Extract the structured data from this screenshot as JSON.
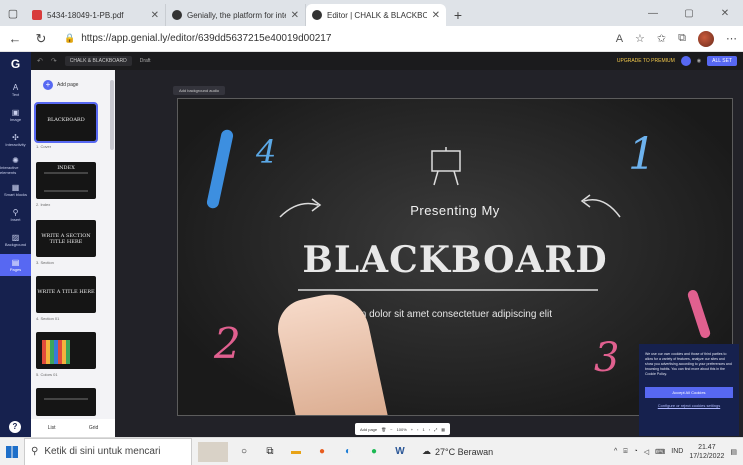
{
  "browser": {
    "tabs": [
      {
        "title": "5434-18049-1-PB.pdf",
        "favicon": "pdf-icon",
        "active": false
      },
      {
        "title": "Genially, the platform for interac",
        "favicon": "genially-icon",
        "active": false
      },
      {
        "title": "Editor | CHALK & BLACKBOARD",
        "favicon": "genially-icon",
        "active": true
      }
    ],
    "url": "https://app.genial.ly/editor/639dd5637215e40019d00217"
  },
  "editor": {
    "top_name": "CHALK & BLACKBOARD",
    "top_chip": "Draft",
    "upgrade_label": "UPGRADE TO PREMIUM",
    "all_set_label": "ALL SET",
    "rail": [
      {
        "label": "Text",
        "icon": "A"
      },
      {
        "label": "Image",
        "icon": "▣"
      },
      {
        "label": "Interactivity",
        "icon": "✣"
      },
      {
        "label": "Interactive elements",
        "icon": "✺"
      },
      {
        "label": "Smart blocks",
        "icon": "▦"
      },
      {
        "label": "Insert",
        "icon": "⚲"
      },
      {
        "label": "Background",
        "icon": "▨"
      },
      {
        "label": "Pages",
        "icon": "▤"
      }
    ],
    "add_page_label": "Add page",
    "thumbnails": [
      {
        "label": "1. Cover",
        "text": "BLACKBOARD"
      },
      {
        "label": "2. Index",
        "text": "INDEX"
      },
      {
        "label": "3. Section",
        "text": "WRITE A SECTION TITLE HERE"
      },
      {
        "label": "4. Section 01",
        "text": "WRITE A TITLE HERE"
      },
      {
        "label": "5. Colors 01",
        "text": ""
      },
      {
        "label": "6.",
        "text": ""
      }
    ],
    "panel_footer": {
      "list": "List",
      "grid": "Grid"
    },
    "canvas_tool_label": "Add background audio",
    "slide": {
      "presenting": "Presenting My",
      "title": "BLACKBOARD",
      "subtitle": "m dolor sit amet consectetuer adipiscing elit",
      "numbers": [
        "4",
        "1",
        "2",
        "3"
      ]
    },
    "zoom_bar": {
      "add_page": "Add page",
      "zoom": "100%",
      "page": "1"
    },
    "cookie": {
      "text": "We use our own cookies and those of third parties to allow for a variety of features, analyze our sites and show you advertising according to your preferences and browsing habits. You can find more about this in the Cookie Policy.",
      "accept": "Accept All Cookies",
      "configure": "Configure or reject cookies settings"
    }
  },
  "taskbar": {
    "search_placeholder": "Ketik di sini untuk mencari",
    "weather": "27°C  Berawan",
    "lang": "IND",
    "time": "21.47",
    "date": "17/12/2022"
  }
}
